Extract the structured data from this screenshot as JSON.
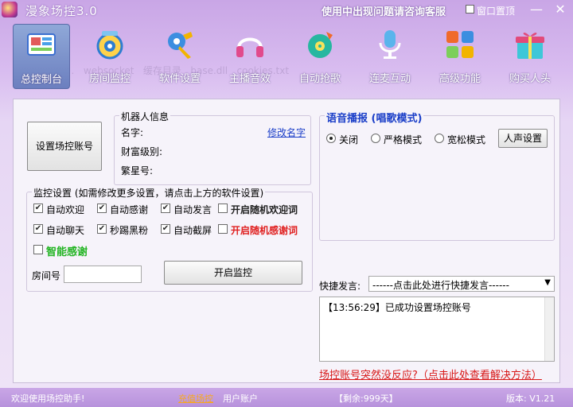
{
  "window": {
    "title": "漫象场控3.0",
    "notice": "使用中出现问题请咨询客服",
    "pin_label": "窗口置顶",
    "minimize": "—",
    "close": "✕"
  },
  "toolbar": {
    "items": [
      {
        "label": "总控制台",
        "icon": "console-icon"
      },
      {
        "label": "房间监控",
        "icon": "room-monitor-icon"
      },
      {
        "label": "软件设置",
        "icon": "settings-wrench-icon"
      },
      {
        "label": "主播音效",
        "icon": "headphones-icon"
      },
      {
        "label": "自动抢歌",
        "icon": "disc-icon"
      },
      {
        "label": "连麦互动",
        "icon": "microphone-icon"
      },
      {
        "label": "高级功能",
        "icon": "app-grid-icon"
      },
      {
        "label": "购买人头",
        "icon": "gift-icon"
      }
    ]
  },
  "left": {
    "set_account_button": "设置场控账号",
    "robot_info": {
      "title": "机器人信息",
      "name_label": "名字:",
      "rename_link": "修改名字",
      "wealth_label": "财富级别:",
      "star_label": "繁星号:"
    },
    "monitor": {
      "title": "监控设置 (如需修改更多设置，请点击上方的软件设置)",
      "options": [
        {
          "label": "自动欢迎",
          "checked": true
        },
        {
          "label": "自动感谢",
          "checked": true
        },
        {
          "label": "自动发言",
          "checked": true
        },
        {
          "label": "开启随机欢迎词",
          "checked": false
        },
        {
          "label": "自动聊天",
          "checked": true
        },
        {
          "label": "秒踢黑粉",
          "checked": true
        },
        {
          "label": "自动截屏",
          "checked": true
        },
        {
          "label": "开启随机感谢词",
          "checked": false
        },
        {
          "label": "智能感谢",
          "checked": false
        }
      ],
      "room_label": "房间号",
      "room_value": "",
      "start_button": "开启监控"
    }
  },
  "right": {
    "voice": {
      "title": "语音播报 (唱歌模式)",
      "options": [
        {
          "label": "关闭",
          "selected": true
        },
        {
          "label": "严格模式",
          "selected": false
        },
        {
          "label": "宽松模式",
          "selected": false
        }
      ],
      "human_voice_button": "人声设置"
    },
    "quick": {
      "label": "快捷发言:",
      "select_value": "------点击此处进行快捷发言------"
    },
    "log": "【13:56:29】已成功设置场控账号",
    "help_link": "场控账号突然没反应?（点击此处查看解决方法）"
  },
  "status": {
    "welcome": "欢迎使用场控助手!",
    "recharge": "充值场控",
    "user_account": "用户账户",
    "remaining": "【剩余:999天】",
    "version": "版本: V1.21"
  },
  "colors": {
    "accent_purple": "#c9a6e6",
    "link_blue": "#1a3ec8",
    "danger_red": "#e02020",
    "success_green": "#22b422",
    "help_red": "#d81818"
  }
}
